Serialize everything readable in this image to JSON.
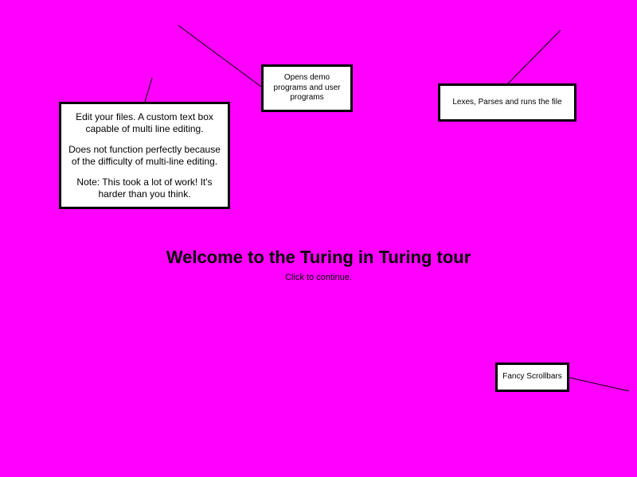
{
  "background_color": "#ff00ff",
  "tour": {
    "title": "Welcome to the Turing in Turing tour",
    "continue_hint": "Click to continue."
  },
  "callouts": {
    "editor": {
      "line1": "Edit your files. A custom text box capable of multi line editing.",
      "line2": "Does not function perfectly because of the difficulty of multi-line editing.",
      "line3": "Note: This took a lot of work! It's harder than you think."
    },
    "open_programs": {
      "text": "Opens demo programs and user programs"
    },
    "run": {
      "text": "Lexes, Parses and runs the file"
    },
    "scrollbars": {
      "text": "Fancy Scrollbars"
    }
  }
}
